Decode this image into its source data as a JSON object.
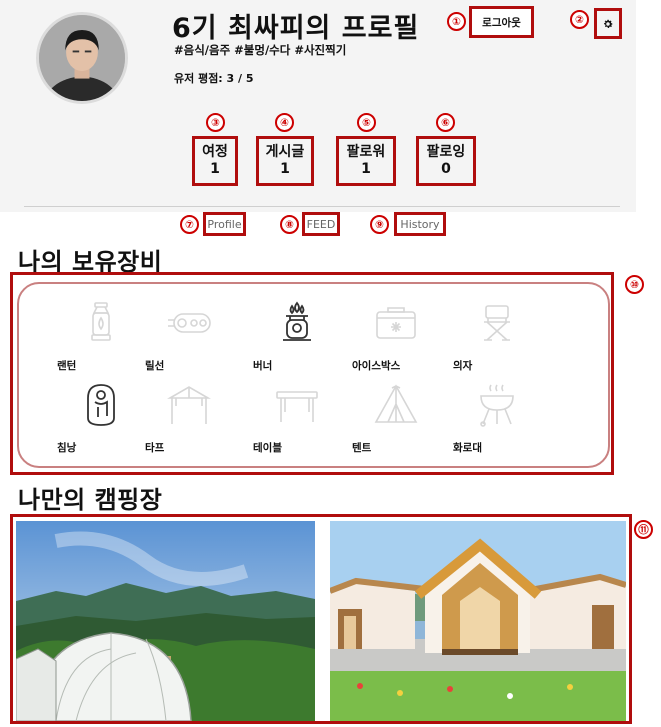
{
  "profile": {
    "title": "6기 최싸피의 프로필",
    "tags": "#음식/음주 #불멍/수다 #사진찍기",
    "rating": "유저 평점: 3 / 5"
  },
  "actions": {
    "logout_label": "로그아웃"
  },
  "stats": [
    {
      "label": "여정",
      "value": "1"
    },
    {
      "label": "게시글",
      "value": "1"
    },
    {
      "label": "팔로워",
      "value": "1"
    },
    {
      "label": "팔로잉",
      "value": "0"
    }
  ],
  "tabs": [
    {
      "label": "Profile"
    },
    {
      "label": "FEED"
    },
    {
      "label": "History"
    }
  ],
  "sections": {
    "gear_title": "나의 보유장비",
    "camp_title": "나만의 캠핑장"
  },
  "gear": [
    {
      "label": "랜턴",
      "icon": "lantern-icon",
      "owned": false
    },
    {
      "label": "릴선",
      "icon": "power-reel-icon",
      "owned": false
    },
    {
      "label": "버너",
      "icon": "burner-icon",
      "owned": true
    },
    {
      "label": "아이스박스",
      "icon": "icebox-icon",
      "owned": false
    },
    {
      "label": "의자",
      "icon": "chair-icon",
      "owned": false
    },
    {
      "label": "침낭",
      "icon": "sleeping-bag-icon",
      "owned": true
    },
    {
      "label": "타프",
      "icon": "tarp-icon",
      "owned": false
    },
    {
      "label": "테이블",
      "icon": "table-icon",
      "owned": false
    },
    {
      "label": "텐트",
      "icon": "tent-icon",
      "owned": false
    },
    {
      "label": "화로대",
      "icon": "grill-icon",
      "owned": false
    }
  ],
  "annotations": [
    "①",
    "②",
    "③",
    "④",
    "⑤",
    "⑥",
    "⑦",
    "⑧",
    "⑨",
    "⑩",
    "⑪"
  ],
  "colors": {
    "annotation": "#b00d0d",
    "header_bg": "#f4f4f4",
    "owned_icon": "#333333",
    "unowned_icon": "#d6d6d6"
  }
}
